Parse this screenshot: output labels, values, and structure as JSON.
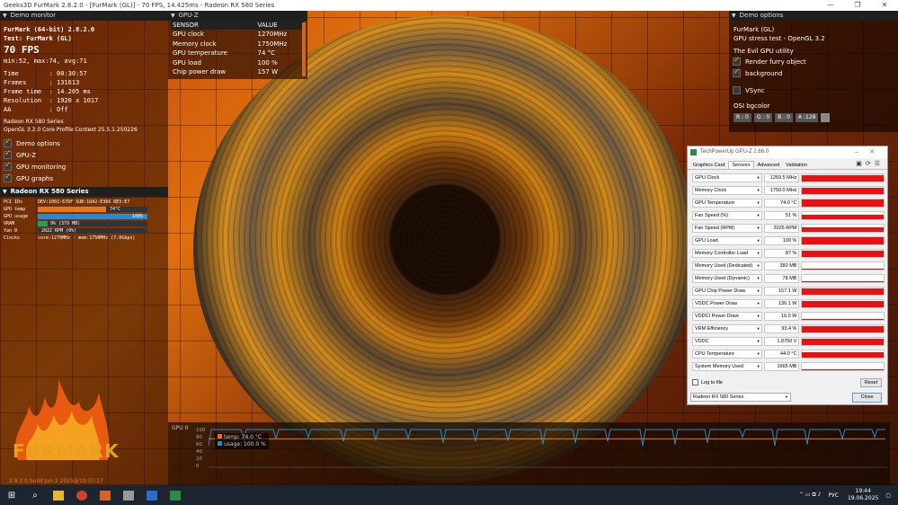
{
  "titlebar": {
    "text": "Geeks3D FurMark 2.8.2.0 - [FurMark (GL)] - 70 FPS, 14.425ms - Radeon RX 580 Series",
    "minimize_icon": "minimize-icon",
    "maximize_icon": "maximize-icon",
    "close_icon": "close-icon"
  },
  "demo_monitor": {
    "header": "Demo monitor",
    "app_version": "FurMark (64-bit) 2.8.2.0",
    "test_name": "Test: FurMark (GL)",
    "fps": "70 FPS",
    "minmaxavg": "min:52, max:74, avg:71",
    "time": "Time        : 00:30:57",
    "frames": "Frames      : 131613",
    "frame_time": "Frame time  : 14.205 ms",
    "resolution": "Resolution  : 1920 x 1017",
    "aa": "AA          : Off",
    "gpu_name": "Radeon RX 580 Series",
    "opengl": "OpenGL 3.2.0 Core Profile Context 25.5.1.250226",
    "checks": [
      {
        "label": "Demo options",
        "checked": true
      },
      {
        "label": "GPU-Z",
        "checked": true
      },
      {
        "label": "GPU monitoring",
        "checked": true
      },
      {
        "label": "GPU graphs",
        "checked": true
      }
    ]
  },
  "gpu_section": {
    "header": "Radeon RX 580 Series",
    "pci_label": "PCI IDs",
    "pci_value": "DEV:1002-67DF SUB:1DA2-E366 REV:E7",
    "gpu_temp_label": "GPU temp",
    "gpu_temp_value": "74°C",
    "gpu_temp_fraction": 0.62,
    "gpu_usage_label": "GPU usage",
    "gpu_usage_value": "100%",
    "gpu_usage_fraction": 1.0,
    "vram_label": "VRAM",
    "vram_value": "9% (379 MB)",
    "vram_fraction": 0.09,
    "fan_label": "fan 0",
    "fan_value": "2022 RPM (0%)",
    "clocks_label": "Clocks",
    "clocks_value": "core:1270MHz - mem:1750MHz (7.0Gbps)"
  },
  "logo": {
    "text": "FURMARK",
    "build": "2.8.2.0 build Jun  2 2025@10:37:17"
  },
  "gpuz_overlay": {
    "header": "GPU-Z",
    "col_sensor": "SENSOR",
    "col_value": "VALUE",
    "rows": [
      {
        "sensor": "GPU clock",
        "value": "1270MHz"
      },
      {
        "sensor": "Memory clock",
        "value": "1750MHz"
      },
      {
        "sensor": "GPU temperature",
        "value": "74 °C"
      },
      {
        "sensor": "GPU load",
        "value": "100 %"
      },
      {
        "sensor": "Chip power draw",
        "value": "157 W"
      }
    ]
  },
  "demo_options": {
    "header": "Demo options",
    "demo": "FurMark (GL)",
    "desc": "GPU stress test - OpenGL 3.2",
    "utility": "The Evil GPU utility",
    "render_furry": "Render furry object",
    "background": "background",
    "vsync": "VSync",
    "osi": "OSI bgcolor",
    "r": "R : 0",
    "g": "G : 0",
    "b": "B : 0",
    "a": "A :128"
  },
  "gpuz_window": {
    "title": "TechPowerUp GPU-Z 2.66.0",
    "tabs": [
      "Graphics Card",
      "Sensors",
      "Advanced",
      "Validation"
    ],
    "active_tab": "Sensors",
    "sensors": [
      {
        "name": "GPU Clock",
        "value": "1269.5 MHz",
        "level": 0.9
      },
      {
        "name": "Memory Clock",
        "value": "1750.0 MHz",
        "level": 0.9
      },
      {
        "name": "GPU Temperature",
        "value": "74.0 °C",
        "level": 0.95
      },
      {
        "name": "Fan Speed (%)",
        "value": "51 %",
        "level": 0.6
      },
      {
        "name": "Fan Speed (RPM)",
        "value": "2025 RPM",
        "level": 0.6
      },
      {
        "name": "GPU Load",
        "value": "100 %",
        "level": 0.95
      },
      {
        "name": "Memory Controller Load",
        "value": "87 %",
        "level": 0.9
      },
      {
        "name": "Memory Used (Dedicated)",
        "value": "380 MB",
        "level": 0.1
      },
      {
        "name": "Memory Used (Dynamic)",
        "value": "78 MB",
        "level": 0.1
      },
      {
        "name": "GPU Chip Power Draw",
        "value": "157.1 W",
        "level": 0.9
      },
      {
        "name": "VDDC Power Draw",
        "value": "136.1 W",
        "level": 0.9
      },
      {
        "name": "VDDCI Power Draw",
        "value": "16.0 W",
        "level": 0.1
      },
      {
        "name": "VRM Efficiency",
        "value": "93.4 %",
        "level": 0.9
      },
      {
        "name": "VDDC",
        "value": "1.0750 V",
        "level": 0.9
      },
      {
        "name": "CPU Temperature",
        "value": "44.0 °C",
        "level": 0.8
      },
      {
        "name": "System Memory Used",
        "value": "1665 MB",
        "level": 0.1
      }
    ],
    "log_to_file": "Log to file",
    "reset": "Reset",
    "gpu_select": "Radeon RX 580 Series",
    "close": "Close"
  },
  "bottom_graph": {
    "label": "GPU 0",
    "y_ticks": [
      "100",
      "80",
      "60",
      "40",
      "20",
      "0"
    ],
    "temp_legend": "temp: 74.0 °C",
    "usage_legend": "usage: 100.0 %",
    "temp_color": "#e07820",
    "usage_color": "#2a8ad0"
  },
  "taskbar": {
    "icons": [
      "windows-start-icon",
      "search-icon",
      "file-explorer-icon",
      "chrome-icon",
      "furmark-icon",
      "gpu-tool-icon",
      "terminal-icon",
      "gpuz-icon"
    ],
    "lang": "РУС",
    "time": "19:44",
    "date": "19.06.2025"
  }
}
